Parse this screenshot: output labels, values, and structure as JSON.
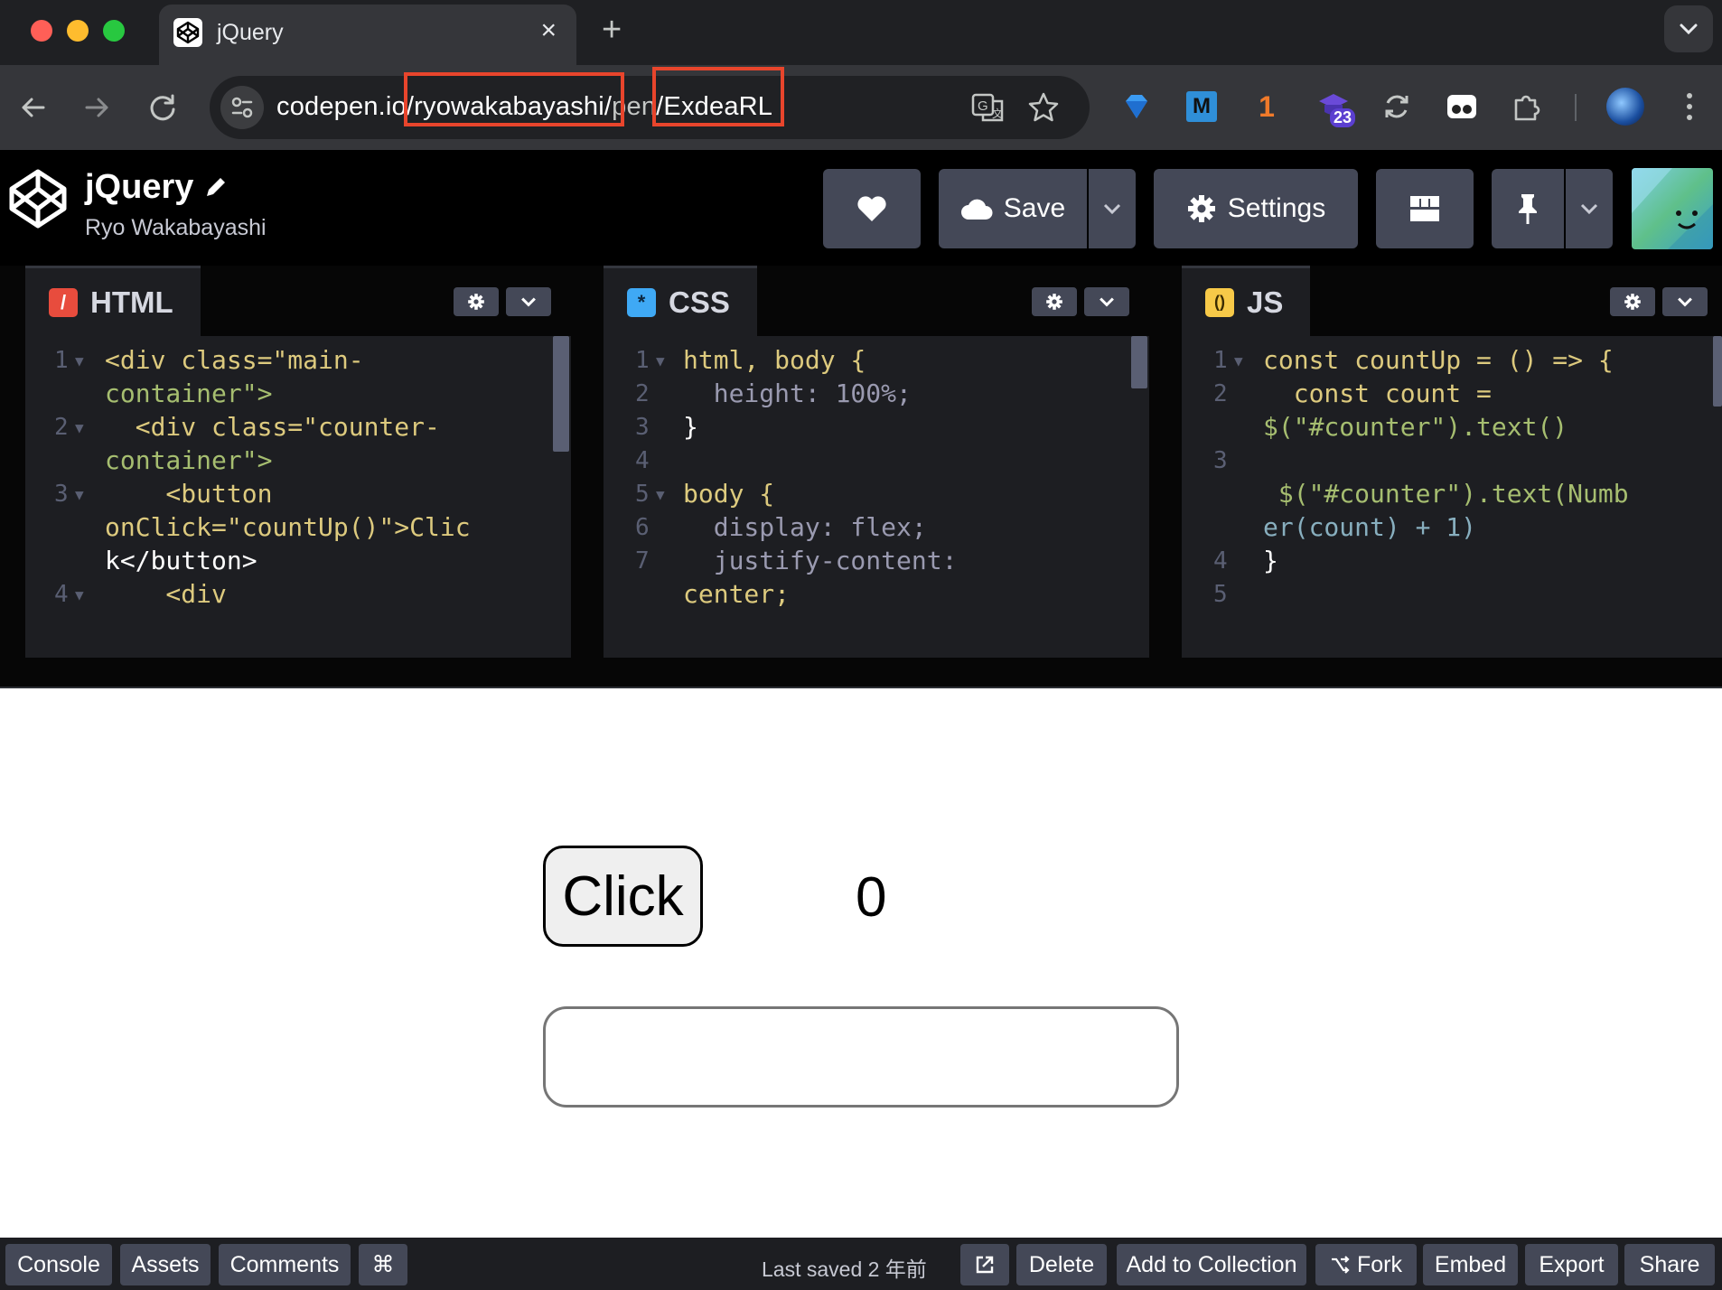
{
  "browser": {
    "tab_title": "jQuery",
    "url_host": "codepen.io",
    "url_user": "/ryowakabayashi/",
    "url_mid": "pen",
    "url_slug": "/ExdeaRL",
    "ext_badge_count": "23",
    "ext_number": "1",
    "ext_m_label": "M"
  },
  "header": {
    "pen_title": "jQuery",
    "author": "Ryo Wakabayashi",
    "save_label": "Save",
    "settings_label": "Settings"
  },
  "editors": {
    "html": {
      "name": "HTML",
      "badge": "/",
      "badge_color": "#e84c3d",
      "line_numbers": [
        "1",
        "2",
        "3",
        "4"
      ],
      "lines": [
        "<div class=\"main-",
        "container\">",
        "  <div class=\"counter-",
        "container\">",
        "    <button",
        "onClick=\"countUp()\">Clic",
        "k</button>",
        "    <div"
      ]
    },
    "css": {
      "name": "CSS",
      "badge": "*",
      "badge_color": "#3fa9f5",
      "line_numbers": [
        "1",
        "2",
        "3",
        "4",
        "5",
        "6",
        "7"
      ],
      "lines": [
        "html, body {",
        "  height: 100%;",
        "}",
        "",
        "body {",
        "  display: flex;",
        "  justify-content:",
        "center;"
      ]
    },
    "js": {
      "name": "JS",
      "badge": "()",
      "badge_color": "#f7c948",
      "line_numbers": [
        "1",
        "2",
        "3",
        "4",
        "5"
      ],
      "lines": [
        "const countUp = () => {",
        "  const count =",
        "$(\"#counter\").text()",
        "",
        " $(\"#counter\").text(Numb",
        "er(count) + 1)",
        "}",
        ""
      ]
    }
  },
  "preview": {
    "button_label": "Click",
    "counter_value": "0",
    "input_value": ""
  },
  "footer": {
    "console": "Console",
    "assets": "Assets",
    "comments": "Comments",
    "shortcuts": "⌘",
    "last_saved": "Last saved 2 年前",
    "delete": "Delete",
    "add_to_collection": "Add to Collection",
    "fork": "Fork",
    "embed": "Embed",
    "export": "Export",
    "share": "Share"
  },
  "colors": {
    "highlight_box": "#e8452c",
    "codepen_button": "#444857",
    "editor_bg": "#1d1e22"
  }
}
